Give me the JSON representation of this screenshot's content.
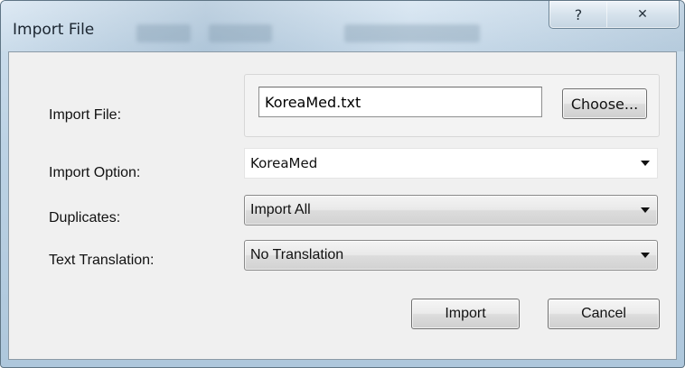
{
  "window": {
    "title": "Import File",
    "help_glyph": "?",
    "close_glyph": "✕"
  },
  "form": {
    "import_file_label": "Import File:",
    "import_file_value": "KoreaMed.txt",
    "choose_label": "Choose...",
    "import_option_label": "Import Option:",
    "import_option_value": "KoreaMed",
    "duplicates_label": "Duplicates:",
    "duplicates_value": "Import All",
    "text_translation_label": "Text Translation:",
    "text_translation_value": "No Translation"
  },
  "actions": {
    "import_label": "Import",
    "cancel_label": "Cancel"
  },
  "icons": {
    "help": "help-icon",
    "close": "close-icon",
    "dropdown": "chevron-down-icon"
  }
}
